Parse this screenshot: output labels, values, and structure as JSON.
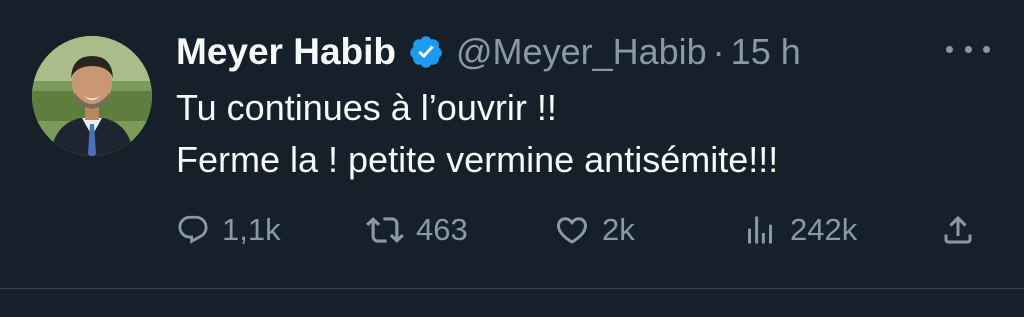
{
  "tweet": {
    "author_name": "Meyer Habib",
    "handle": "@Meyer_Habib",
    "separator": "·",
    "time": "15 h",
    "text_line1": "Tu continues à l’ouvrir !!",
    "text_line2": "Ferme la ! petite vermine antisémite!!!",
    "replies": "1,1k",
    "reposts": "463",
    "likes": "2k",
    "views": "242k"
  },
  "icons": {
    "verified": "verified-badge-icon",
    "more": "more-options-icon",
    "reply": "reply-icon",
    "repost": "repost-icon",
    "like": "like-icon",
    "views": "views-icon",
    "share": "share-icon"
  },
  "colors": {
    "background": "#15202b",
    "primary_text": "#f7f9f9",
    "secondary_text": "#8b98a5",
    "verified": "#1d9bf0",
    "divider": "#38444d"
  }
}
